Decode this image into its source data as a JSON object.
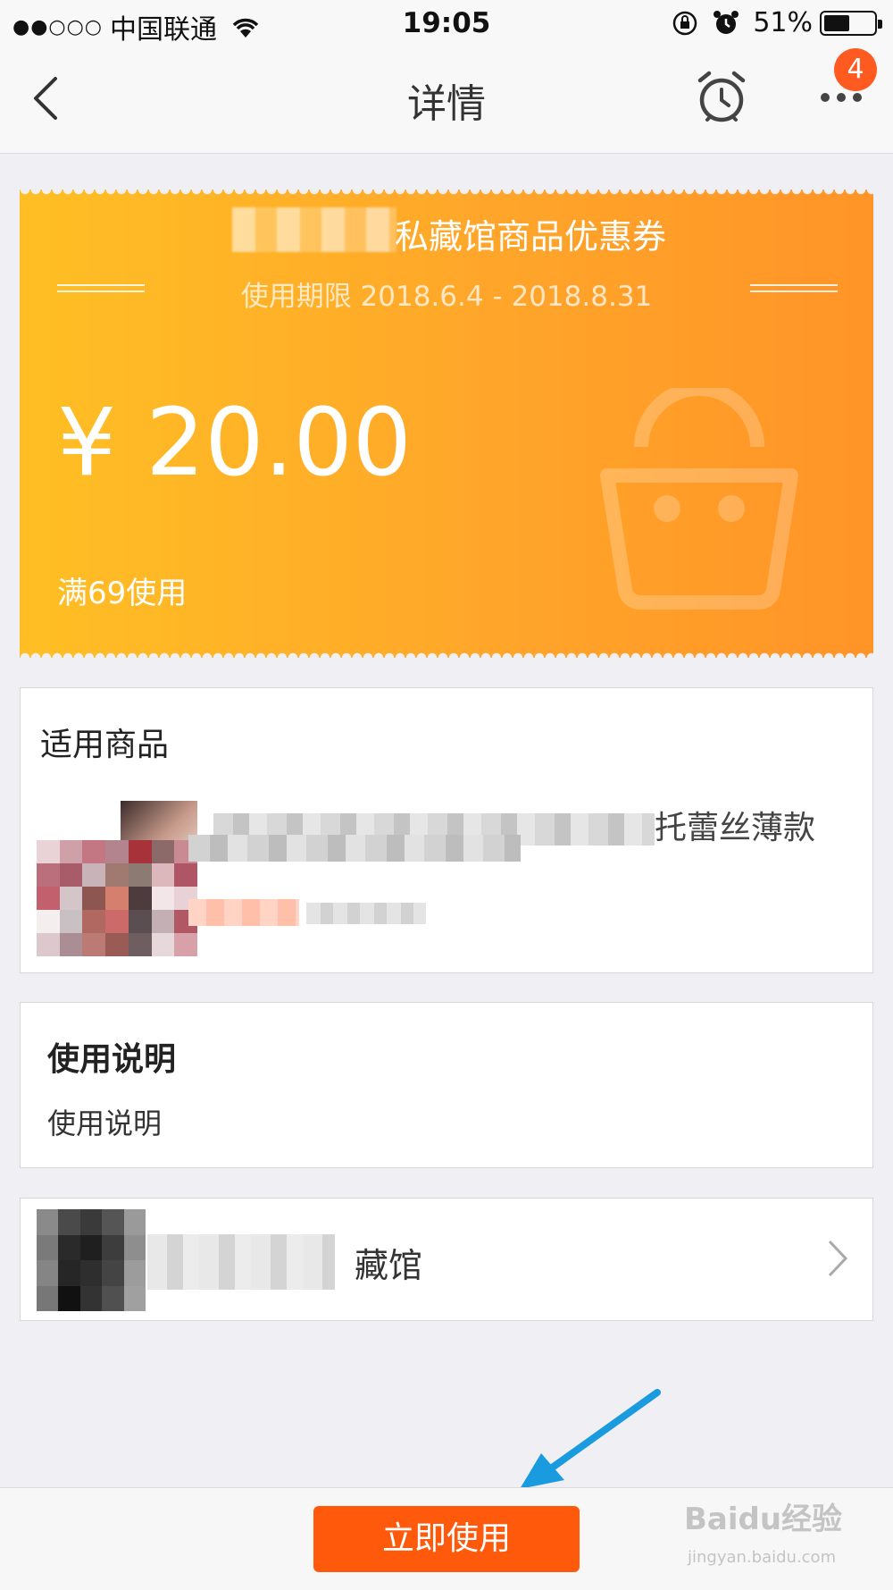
{
  "status_bar": {
    "signal": "●●○○○",
    "carrier": "中国联通",
    "time": "19:05",
    "battery": "51%",
    "battery_level": 0.51
  },
  "nav": {
    "title": "详情",
    "badge_count": "4"
  },
  "coupon": {
    "title": "私藏馆商品优惠券",
    "validity": "使用期限 2018.6.4 - 2018.8.31",
    "amount": "¥ 20.00",
    "min_spend": "满69使用"
  },
  "products": {
    "title": "适用商品",
    "visible_name_fragment": "托蕾丝薄款"
  },
  "usage": {
    "title": "使用说明",
    "text": "使用说明"
  },
  "store": {
    "name_fragment": "藏馆"
  },
  "bottom": {
    "use_button": "立即使用"
  },
  "watermark": {
    "logo": "Baidu经验",
    "url": "jingyan.baidu.com"
  },
  "colors": {
    "accent": "#ff5a0b",
    "coupon_start": "#ffbf24",
    "coupon_end": "#ff9427",
    "arrow": "#1a9be0"
  }
}
